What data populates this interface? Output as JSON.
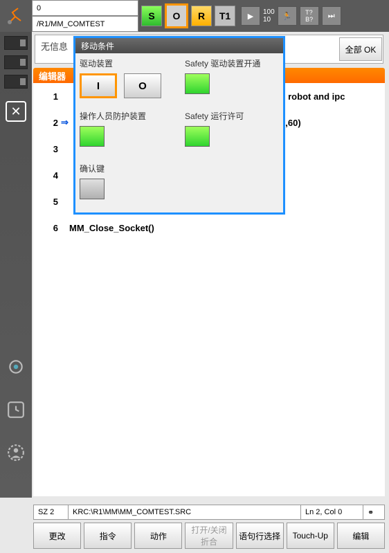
{
  "topbar": {
    "info_line1": "0",
    "info_line2": "/R1/MM_COMTEST",
    "s_label": "S",
    "o_label": "O",
    "r_label": "R",
    "t1_label": "T1",
    "speed_top": "100",
    "speed_bottom": "10",
    "tb_label": "T?\nB?"
  },
  "msgbar": {
    "text": "无信息",
    "all_ok": "全部 OK"
  },
  "editor": {
    "header": "编辑器",
    "lines": [
      {
        "n": "1",
        "text": "ween robot and ipc"
      },
      {
        "n": "2",
        "text": "\"1,60)"
      },
      {
        "n": "3",
        "text": ""
      },
      {
        "n": "4",
        "text": ""
      },
      {
        "n": "5",
        "text": ""
      },
      {
        "n": "6",
        "text": "MM_Close_Socket()"
      }
    ]
  },
  "status": {
    "seg1": "SZ 2",
    "seg2": "KRC:\\R1\\MM\\MM_COMTEST.SRC",
    "seg3": "Ln 2, Col 0",
    "seg4": "⚭"
  },
  "bottom": {
    "b1": "更改",
    "b2": "指令",
    "b3": "动作",
    "b4": "打开/关闭\n折合",
    "b5": "语句行选择",
    "b6": "Touch-Up",
    "b7": "编辑"
  },
  "popup": {
    "title": "移动条件",
    "drive_label": "驱动装置",
    "drive_i": "I",
    "drive_o": "O",
    "safety_drive_label": "Safety 驱动装置开通",
    "operator_label": "操作人员防护装置",
    "safety_run_label": "Safety 运行许可",
    "confirm_label": "确认键"
  }
}
